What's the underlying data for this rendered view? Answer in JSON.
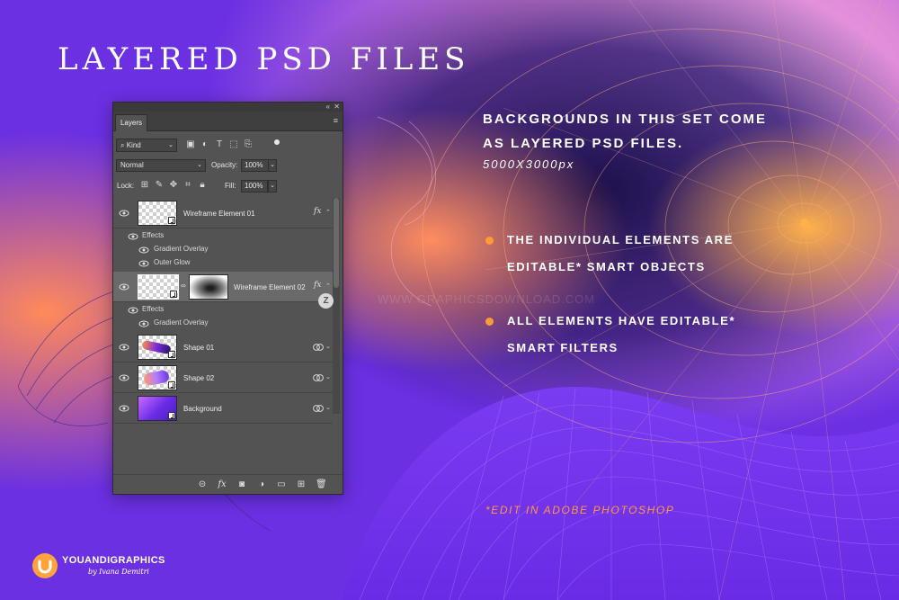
{
  "headline": "LAYERED PSD FILES",
  "copy": {
    "title": "BACKGROUNDS IN THIS SET COME AS LAYERED PSD FILES.",
    "size": "5000X3000px",
    "bullets": [
      "THE INDIVIDUAL ELEMENTS ARE EDITABLE* SMART OBJECTS",
      "ALL ELEMENTS HAVE EDITABLE* SMART FILTERS"
    ],
    "footnote": "*EDIT IN ADOBE PHOTOSHOP"
  },
  "panel": {
    "tab": "Layers",
    "kind": "Kind",
    "blend_mode": "Normal",
    "opacity_label": "Opacity:",
    "opacity": "100%",
    "lock_label": "Lock:",
    "fill_label": "Fill:",
    "fill": "100%",
    "effects_label": "Effects",
    "layers": [
      {
        "name": "Wireframe Element 01",
        "effects": [
          "Gradient Overlay",
          "Outer Glow"
        ]
      },
      {
        "name": "Wireframe Element 02",
        "effects": [
          "Gradient Overlay"
        ],
        "selected": true
      },
      {
        "name": "Shape 01"
      },
      {
        "name": "Shape 02"
      },
      {
        "name": "Background"
      }
    ],
    "icons": {
      "filter": [
        "image-filter-icon",
        "adjustment-filter-icon",
        "type-filter-icon",
        "shape-filter-icon",
        "smart-object-filter-icon"
      ],
      "lock": [
        "lock-transparent-icon",
        "lock-image-icon",
        "lock-position-icon",
        "lock-artboard-icon",
        "lock-all-icon"
      ],
      "footer": [
        "link-layers-icon",
        "fx-icon",
        "add-mask-icon",
        "adjustment-layer-icon",
        "new-group-icon",
        "new-layer-icon",
        "delete-layer-icon"
      ]
    }
  },
  "brand": {
    "name": "YOUANDIGRAPHICS",
    "sub": "by Ivana Demitri"
  },
  "colors": {
    "accent": "#ff9a3c",
    "purple": "#6a2fe0",
    "panel": "#535353"
  }
}
